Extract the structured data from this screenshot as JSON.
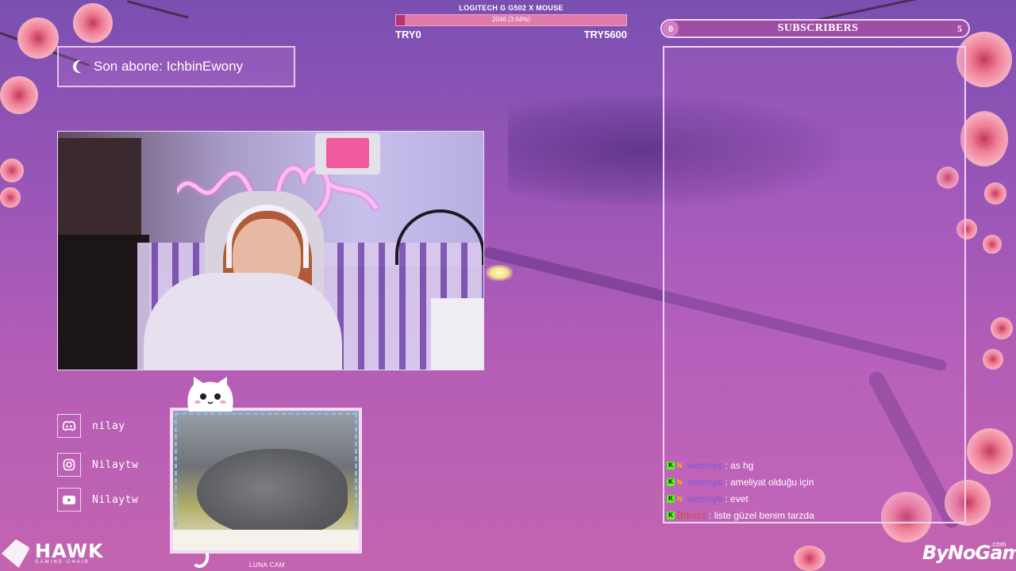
{
  "goal": {
    "title": "LOGITECH G G502 X MOUSE",
    "progress_text": "2046 (3.64%)",
    "progress_fraction": 0.0364,
    "start_label": "TRY0",
    "end_label": "TRY5600"
  },
  "last_subscriber": {
    "text": "Son abone: IchbinEwony"
  },
  "socials": [
    {
      "icon": "discord-icon",
      "label": "nilay"
    },
    {
      "icon": "instagram-icon",
      "label": "Nilaytw"
    },
    {
      "icon": "youtube-icon",
      "label": "Nilaytw"
    }
  ],
  "cat_cam": {
    "caption": "LUNA CAM"
  },
  "subscribers": {
    "title": "SUBSCRIBERS",
    "current": "0",
    "goal": "5"
  },
  "chat": {
    "messages": [
      {
        "user": "womnys",
        "text": ": as hg",
        "user_color": "#7e57d6"
      },
      {
        "user": "womnys",
        "text": ": ameliyat olduğu için",
        "user_color": "#7e57d6"
      },
      {
        "user": "womnys",
        "text": ": evet",
        "user_color": "#7e57d6"
      },
      {
        "user": "Brknxs",
        "text": ": liste güzel benim tarzda",
        "user_color": "#c9503e"
      }
    ]
  },
  "sponsors": {
    "hawk": "HAWK",
    "hawk_sub": "GAMING CHAIR",
    "bynogame": "ByNoGame",
    "bynogame_suffix": ".com"
  },
  "colors": {
    "kick_green": "#53fc18",
    "goal_fill": "#b83272",
    "frame": "#f0d6f2"
  }
}
